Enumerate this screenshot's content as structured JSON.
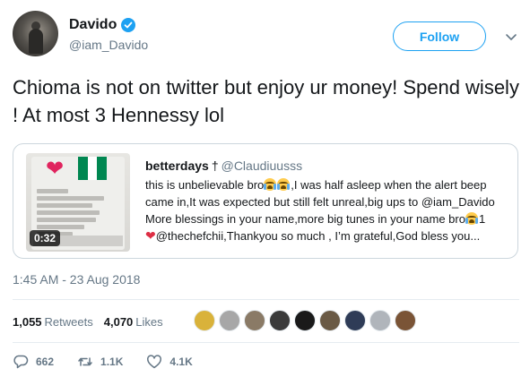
{
  "author": {
    "display_name": "Davido",
    "handle": "@iam_Davido",
    "verified": true
  },
  "follow_label": "Follow",
  "tweet_text": "Chioma is not on twitter but enjoy ur money! Spend wisely ! At most 3 Hennessy lol",
  "quoted": {
    "display_name": "betterdays",
    "dagger": "†",
    "handle": "@Claudiuusss",
    "text_1": "this is unbelievable bro",
    "text_2": ",I was half asleep when the alert beep came in,It was expected but still felt unreal,big ups to @iam_Davido More blessings in your name,more big tunes in your name bro",
    "text_3": "1",
    "text_4": "@thechefchii,Thankyou so much , I’m grateful,God bless you...",
    "video_duration": "0:32"
  },
  "timestamp": "1:45 AM - 23 Aug 2018",
  "stats": {
    "retweets_count": "1,055",
    "retweets_label": "Retweets",
    "likes_count": "4,070",
    "likes_label": "Likes"
  },
  "likers": [
    {
      "color": "#d9b23a"
    },
    {
      "color": "#a7a7a7"
    },
    {
      "color": "#8a7a66"
    },
    {
      "color": "#3b3b3b"
    },
    {
      "color": "#1a1a1a"
    },
    {
      "color": "#6a5a45"
    },
    {
      "color": "#2f3c57"
    },
    {
      "color": "#b0b5bb"
    },
    {
      "color": "#7a5436"
    }
  ],
  "actions": {
    "replies": "662",
    "retweets": "1.1K",
    "likes": "4.1K"
  },
  "colors": {
    "accent": "#1da1f2",
    "muted": "#657786",
    "border": "#e6ecf0"
  },
  "icons": [
    "verified-badge-icon",
    "chevron-down-icon",
    "play-icon",
    "reply-icon",
    "retweet-icon",
    "like-icon",
    "crying-face-emoji",
    "red-heart-emoji"
  ]
}
